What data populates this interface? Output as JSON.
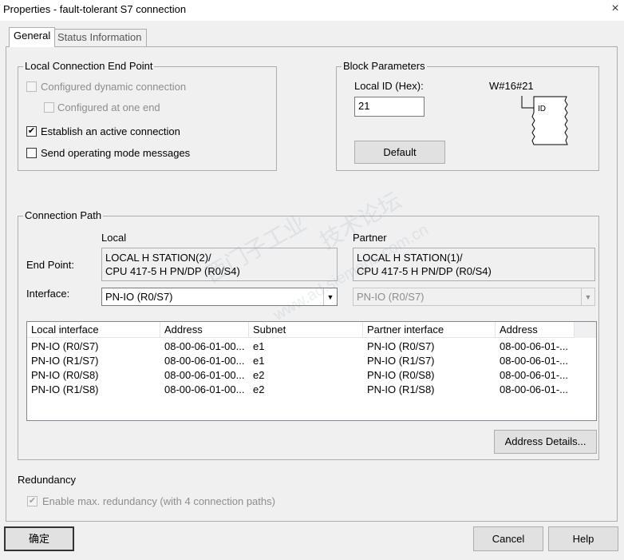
{
  "window": {
    "title": "Properties - fault-tolerant  S7 connection",
    "close_label": "×"
  },
  "tabs": [
    {
      "label": "General"
    },
    {
      "label": "Status Information"
    }
  ],
  "local_endpoint": {
    "legend": "Local Connection End Point",
    "configured_dynamic": {
      "label": "Configured dynamic connection",
      "checked": false
    },
    "configured_one_end": {
      "label": "Configured at one end",
      "checked": false
    },
    "establish_active": {
      "label": "Establish an active connection",
      "checked": true,
      "mark": "✔"
    },
    "send_mode_messages": {
      "label": "Send operating mode messages",
      "checked": false
    }
  },
  "block_params": {
    "legend": "Block Parameters",
    "local_id_label": "Local ID (Hex):",
    "local_id_value": "21",
    "default_button": "Default",
    "diagram_header": "W#16#21",
    "diagram_pin": "ID"
  },
  "connection_path": {
    "legend": "Connection Path",
    "local_heading": "Local",
    "partner_heading": "Partner",
    "end_point_label": "End Point:",
    "interface_label": "Interface:",
    "local_end_point": "LOCAL H STATION(2)/\nCPU 417-5 H PN/DP (R0/S4)",
    "partner_end_point": "LOCAL H STATION(1)/\nCPU 417-5 H PN/DP (R0/S4)",
    "local_interface": "PN-IO (R0/S7)",
    "partner_interface": "PN-IO (R0/S7)",
    "table": {
      "headers": [
        "Local interface",
        "Address",
        "Subnet",
        "Partner interface",
        "Address"
      ],
      "rows": [
        [
          "PN-IO (R0/S7)",
          "08-00-06-01-00...",
          "e1",
          "PN-IO (R0/S7)",
          "08-00-06-01-..."
        ],
        [
          "PN-IO (R1/S7)",
          "08-00-06-01-00...",
          "e1",
          "PN-IO (R1/S7)",
          "08-00-06-01-..."
        ],
        [
          "PN-IO (R0/S8)",
          "08-00-06-01-00...",
          "e2",
          "PN-IO (R0/S8)",
          "08-00-06-01-..."
        ],
        [
          "PN-IO (R1/S8)",
          "08-00-06-01-00...",
          "e2",
          "PN-IO (R1/S8)",
          "08-00-06-01-..."
        ]
      ]
    },
    "address_details_button": "Address Details..."
  },
  "redundancy": {
    "heading": "Redundancy",
    "enable_max": {
      "label": "Enable max. redundancy (with 4 connection paths)",
      "checked": true,
      "mark": "✔"
    }
  },
  "footer": {
    "ok_button": "确定",
    "cancel_button": "Cancel",
    "help_button": "Help"
  },
  "icons": {
    "checkmark": "check-icon",
    "dropdown": "chevron-down-icon"
  },
  "watermark": {
    "line1": "技术论坛",
    "line2": "西门子工业",
    "line3": "www.ad.siemens.com.cn"
  }
}
